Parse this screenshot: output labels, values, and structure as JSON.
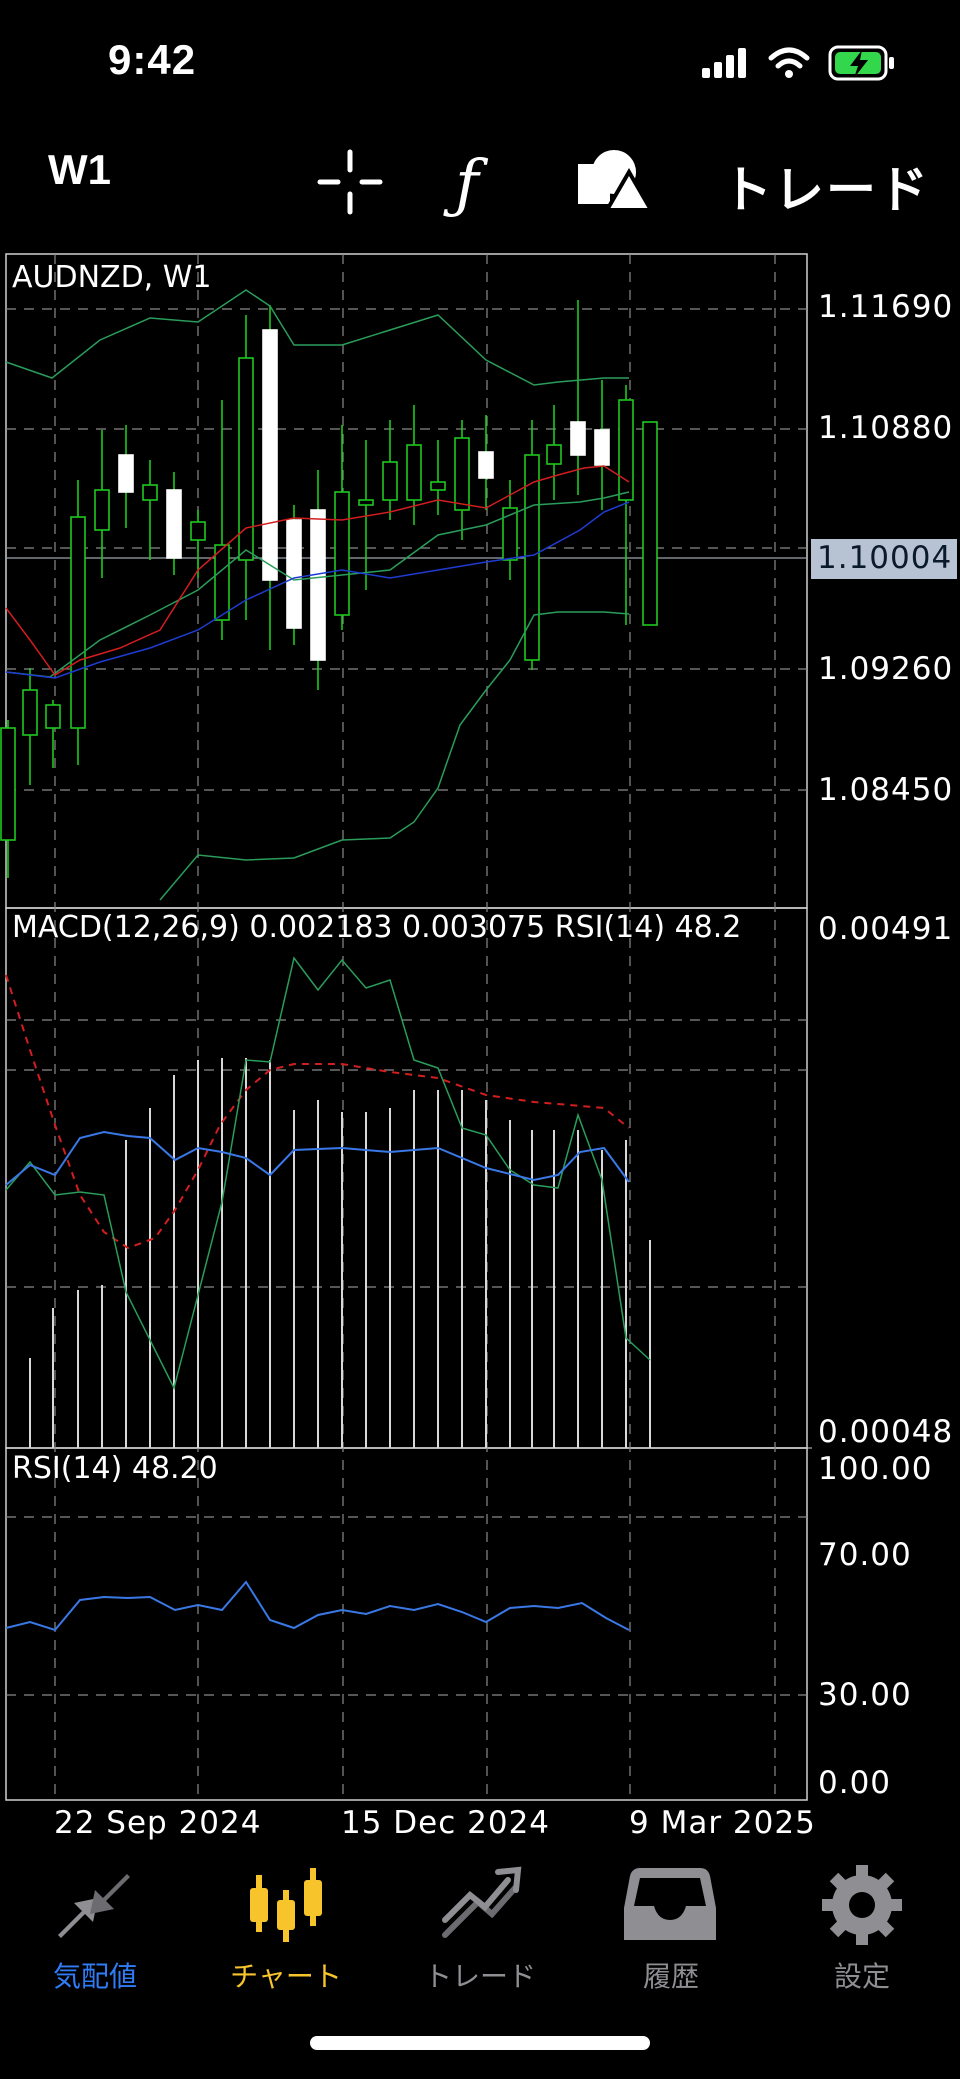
{
  "status_bar": {
    "time": "9:42"
  },
  "toolbar": {
    "timeframe": "W1",
    "icons": [
      "crosshair-icon",
      "function-icon",
      "shapes-icon"
    ],
    "trade_label": "トレード"
  },
  "chart": {
    "symbol_label": "AUDNZD, W1",
    "price_ticks": [
      "1.11690",
      "1.10880",
      "1.09260",
      "1.08450"
    ],
    "current_price": "1.10004",
    "macd_label": "MACD(12,26,9) 0.002183 0.003075 RSI(14) 48.2",
    "macd_ticks": [
      "0.00491",
      "0.00048"
    ],
    "rsi_label": "RSI(14) 48.20",
    "rsi_ticks": [
      "100.00",
      "70.00",
      "30.00",
      "0.00"
    ],
    "date_labels": [
      "22 Sep 2024",
      "15 Dec 2024",
      "9 Mar 2025"
    ],
    "colors": {
      "bull": "#1ec81e",
      "bear": "#ffffff",
      "band": "#2a9d5a",
      "ma_red": "#d21e1e",
      "ma_blue": "#1e3cd2",
      "rsi": "#3a78e6",
      "price_tag_bg": "#b7c3d3"
    }
  },
  "tab_bar": {
    "items": [
      {
        "label": "気配値",
        "icon": "quotes-arrows-icon",
        "color": "#2f7cf6"
      },
      {
        "label": "チャート",
        "icon": "candles-icon",
        "color": "#f7c52b"
      },
      {
        "label": "トレード",
        "icon": "trade-line-icon",
        "color": "#8e8e93"
      },
      {
        "label": "履歴",
        "icon": "history-tray-icon",
        "color": "#8e8e93"
      },
      {
        "label": "設定",
        "icon": "gear-icon",
        "color": "#8e8e93"
      }
    ]
  }
}
